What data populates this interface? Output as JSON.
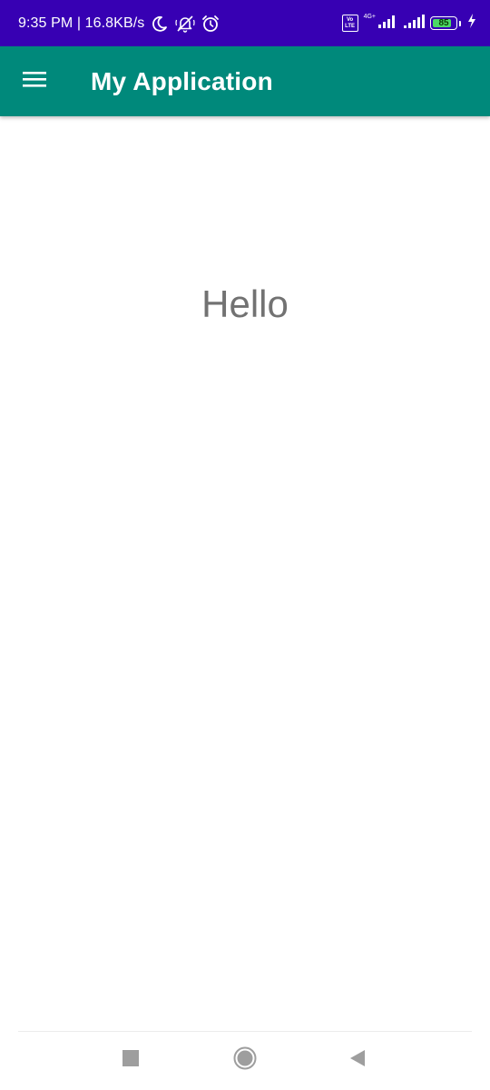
{
  "status_bar": {
    "time_and_speed": "9:35 PM | 16.8KB/s",
    "icons": [
      "moon-icon",
      "muted-bell-icon",
      "alarm-icon",
      "volte-icon",
      "signal-icon",
      "signal-icon",
      "battery-icon",
      "charging-icon"
    ],
    "volte_label_top": "Vo",
    "volte_label_bottom": "LTE",
    "network_type": "4G+",
    "battery_level": "85",
    "battery_fraction": 0.85,
    "background_color": "#3700b3"
  },
  "app_bar": {
    "title": "My Application",
    "menu_icon": "menu-icon",
    "background_color": "#00897b"
  },
  "content": {
    "greeting": "Hello"
  },
  "nav_bar": {
    "buttons": [
      "recents-square-icon",
      "home-circle-icon",
      "back-triangle-icon"
    ]
  }
}
